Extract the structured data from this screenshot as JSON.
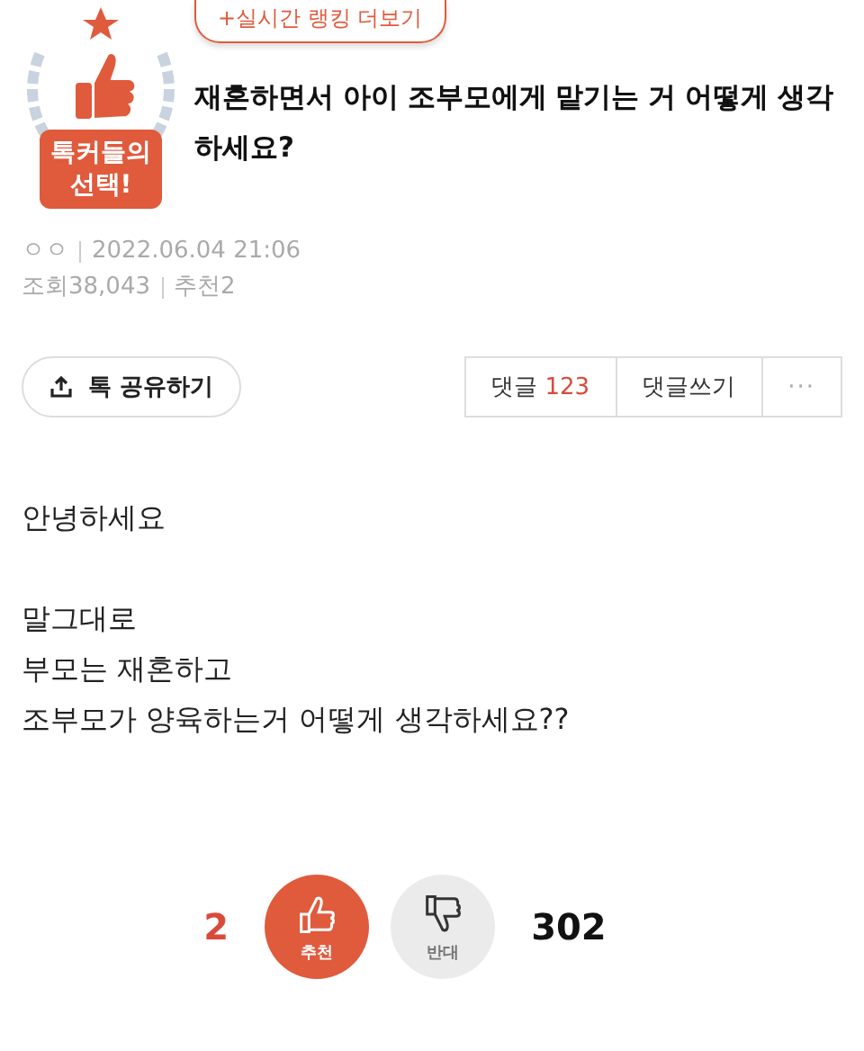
{
  "badge": {
    "text": "톡커들의 선택!"
  },
  "ranking_link": "+실시간 랭킹 더보기",
  "title": "재혼하면서 아이 조부모에게 맡기는 거 어떻게 생각하세요?",
  "meta": {
    "author": "ㅇㅇ",
    "date": "2022.06.04 21:06",
    "views_label": "조회",
    "views": "38,043",
    "recommend_label": "추천",
    "recommend": "2"
  },
  "share_button": "톡 공유하기",
  "comment_bar": {
    "comments_label": "댓글",
    "comments": "123",
    "write": "댓글쓰기",
    "more": "···"
  },
  "body": [
    [
      "안녕하세요"
    ],
    [
      "말그대로",
      "부모는 재혼하고",
      "조부모가 양육하는거 어떻게 생각하세요??"
    ]
  ],
  "votes": [
    {
      "kind": "up",
      "count": "2",
      "label": "추천"
    },
    {
      "kind": "down",
      "count": "302",
      "label": "반대"
    }
  ]
}
